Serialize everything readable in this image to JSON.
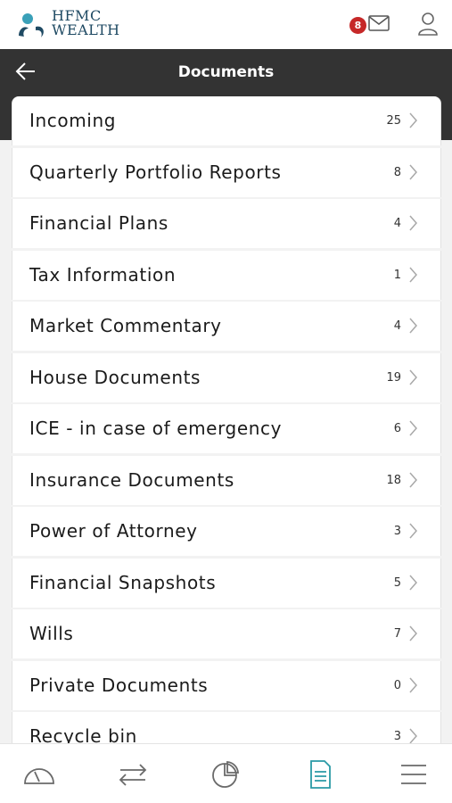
{
  "brand": {
    "line1": "HFMC",
    "line2": "WEALTH",
    "color": "#1f4a63",
    "accent": "#3aa0b8"
  },
  "header": {
    "title": "Documents",
    "background": "#333333",
    "back_icon": "arrow-left-icon"
  },
  "notifications": {
    "count": "8",
    "icon": "mail-icon",
    "badge_color": "#c62828"
  },
  "account_icon": "user-icon",
  "documents": [
    {
      "label": "Incoming",
      "count": "25"
    },
    {
      "label": "Quarterly Portfolio Reports",
      "count": "8"
    },
    {
      "label": "Financial Plans",
      "count": "4"
    },
    {
      "label": "Tax Information",
      "count": "1"
    },
    {
      "label": "Market Commentary",
      "count": "4"
    },
    {
      "label": "House Documents",
      "count": "19"
    },
    {
      "label": "ICE - in case of emergency",
      "count": "6"
    },
    {
      "label": "Insurance Documents",
      "count": "18"
    },
    {
      "label": "Power of Attorney",
      "count": "3"
    },
    {
      "label": "Financial Snapshots",
      "count": "5"
    },
    {
      "label": "Wills",
      "count": "7"
    },
    {
      "label": "Private Documents",
      "count": "0"
    },
    {
      "label": "Recycle bin",
      "count": "3"
    }
  ],
  "bottom_nav": [
    {
      "icon": "dashboard-gauge-icon",
      "active": false
    },
    {
      "icon": "transfer-arrows-icon",
      "active": false
    },
    {
      "icon": "pie-chart-icon",
      "active": false
    },
    {
      "icon": "document-icon",
      "active": true
    },
    {
      "icon": "menu-icon",
      "active": false
    }
  ],
  "colors": {
    "nav_inactive": "#6a6a6a",
    "nav_active": "#2a9aa6"
  }
}
